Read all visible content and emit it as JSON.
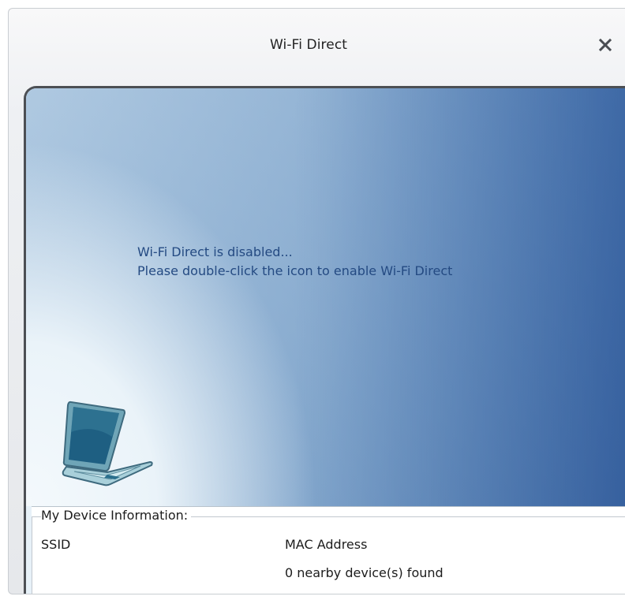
{
  "window": {
    "title": "Wi-Fi Direct"
  },
  "title_bar": {
    "close_icon": "close-icon"
  },
  "status": {
    "line1": "Wi-Fi Direct is disabled...",
    "line2": "Please double-click the icon to enable Wi-Fi Direct"
  },
  "device_icon": "laptop-icon",
  "device_info": {
    "group_label": "My Device Information:",
    "ssid_label": "SSID",
    "mac_label": "MAC Address",
    "nearby_text": "0 nearby device(s) found"
  },
  "colors": {
    "accent": "#244a82",
    "frame": "#4c4f54",
    "sky_edge": "#7ba4cf"
  }
}
